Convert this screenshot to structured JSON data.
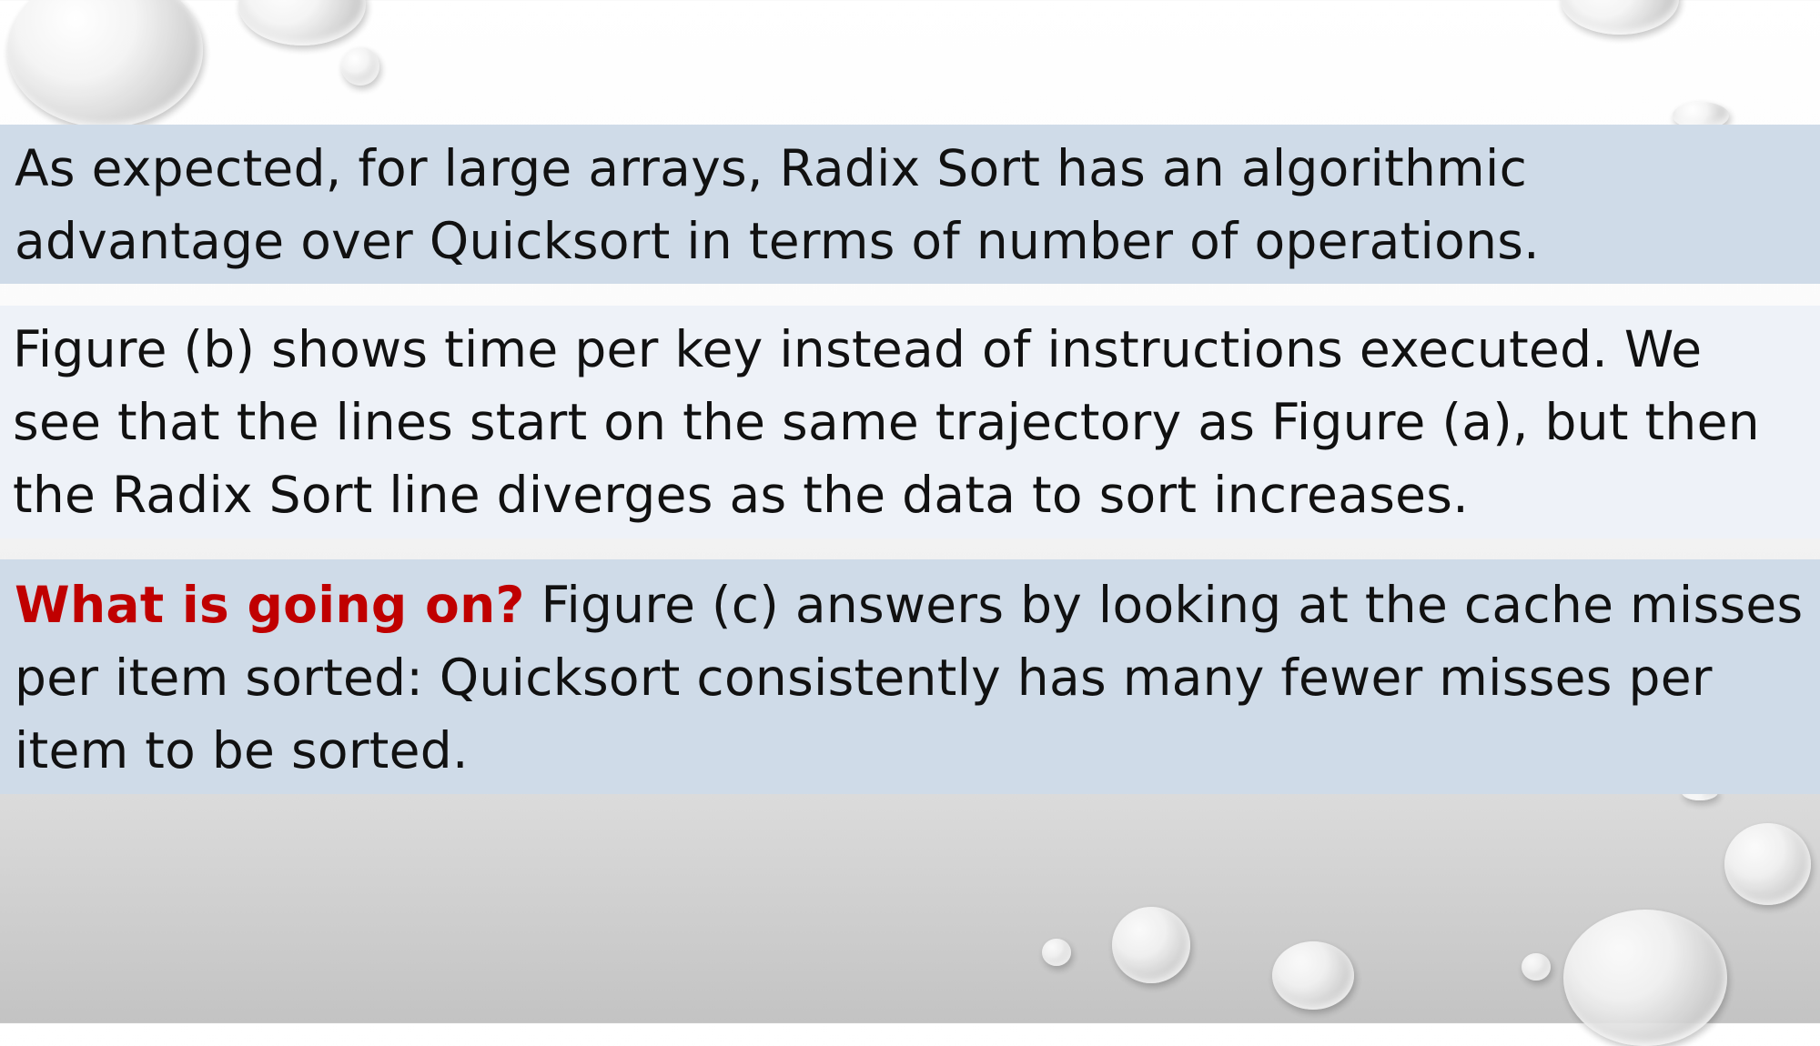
{
  "slide": {
    "paragraph_1": "As expected, for large arrays, Radix Sort has an algorithmic advantage over Quicksort in terms of number of operations.",
    "paragraph_2": "Figure (b) shows time per key instead of instructions executed. We see that the lines start on the same trajectory as Figure (a), but then the Radix Sort line diverges as the data to sort increases.",
    "paragraph_3_emphasis": "What is going on?",
    "paragraph_3_body": " Figure (c) answers by looking at the cache misses per item sorted: Quicksort consistently has many fewer misses per item to be sorted."
  },
  "colors": {
    "box_blue": "#cfdbe8",
    "box_light": "#eef2f8",
    "emphasis_red": "#c00000"
  }
}
